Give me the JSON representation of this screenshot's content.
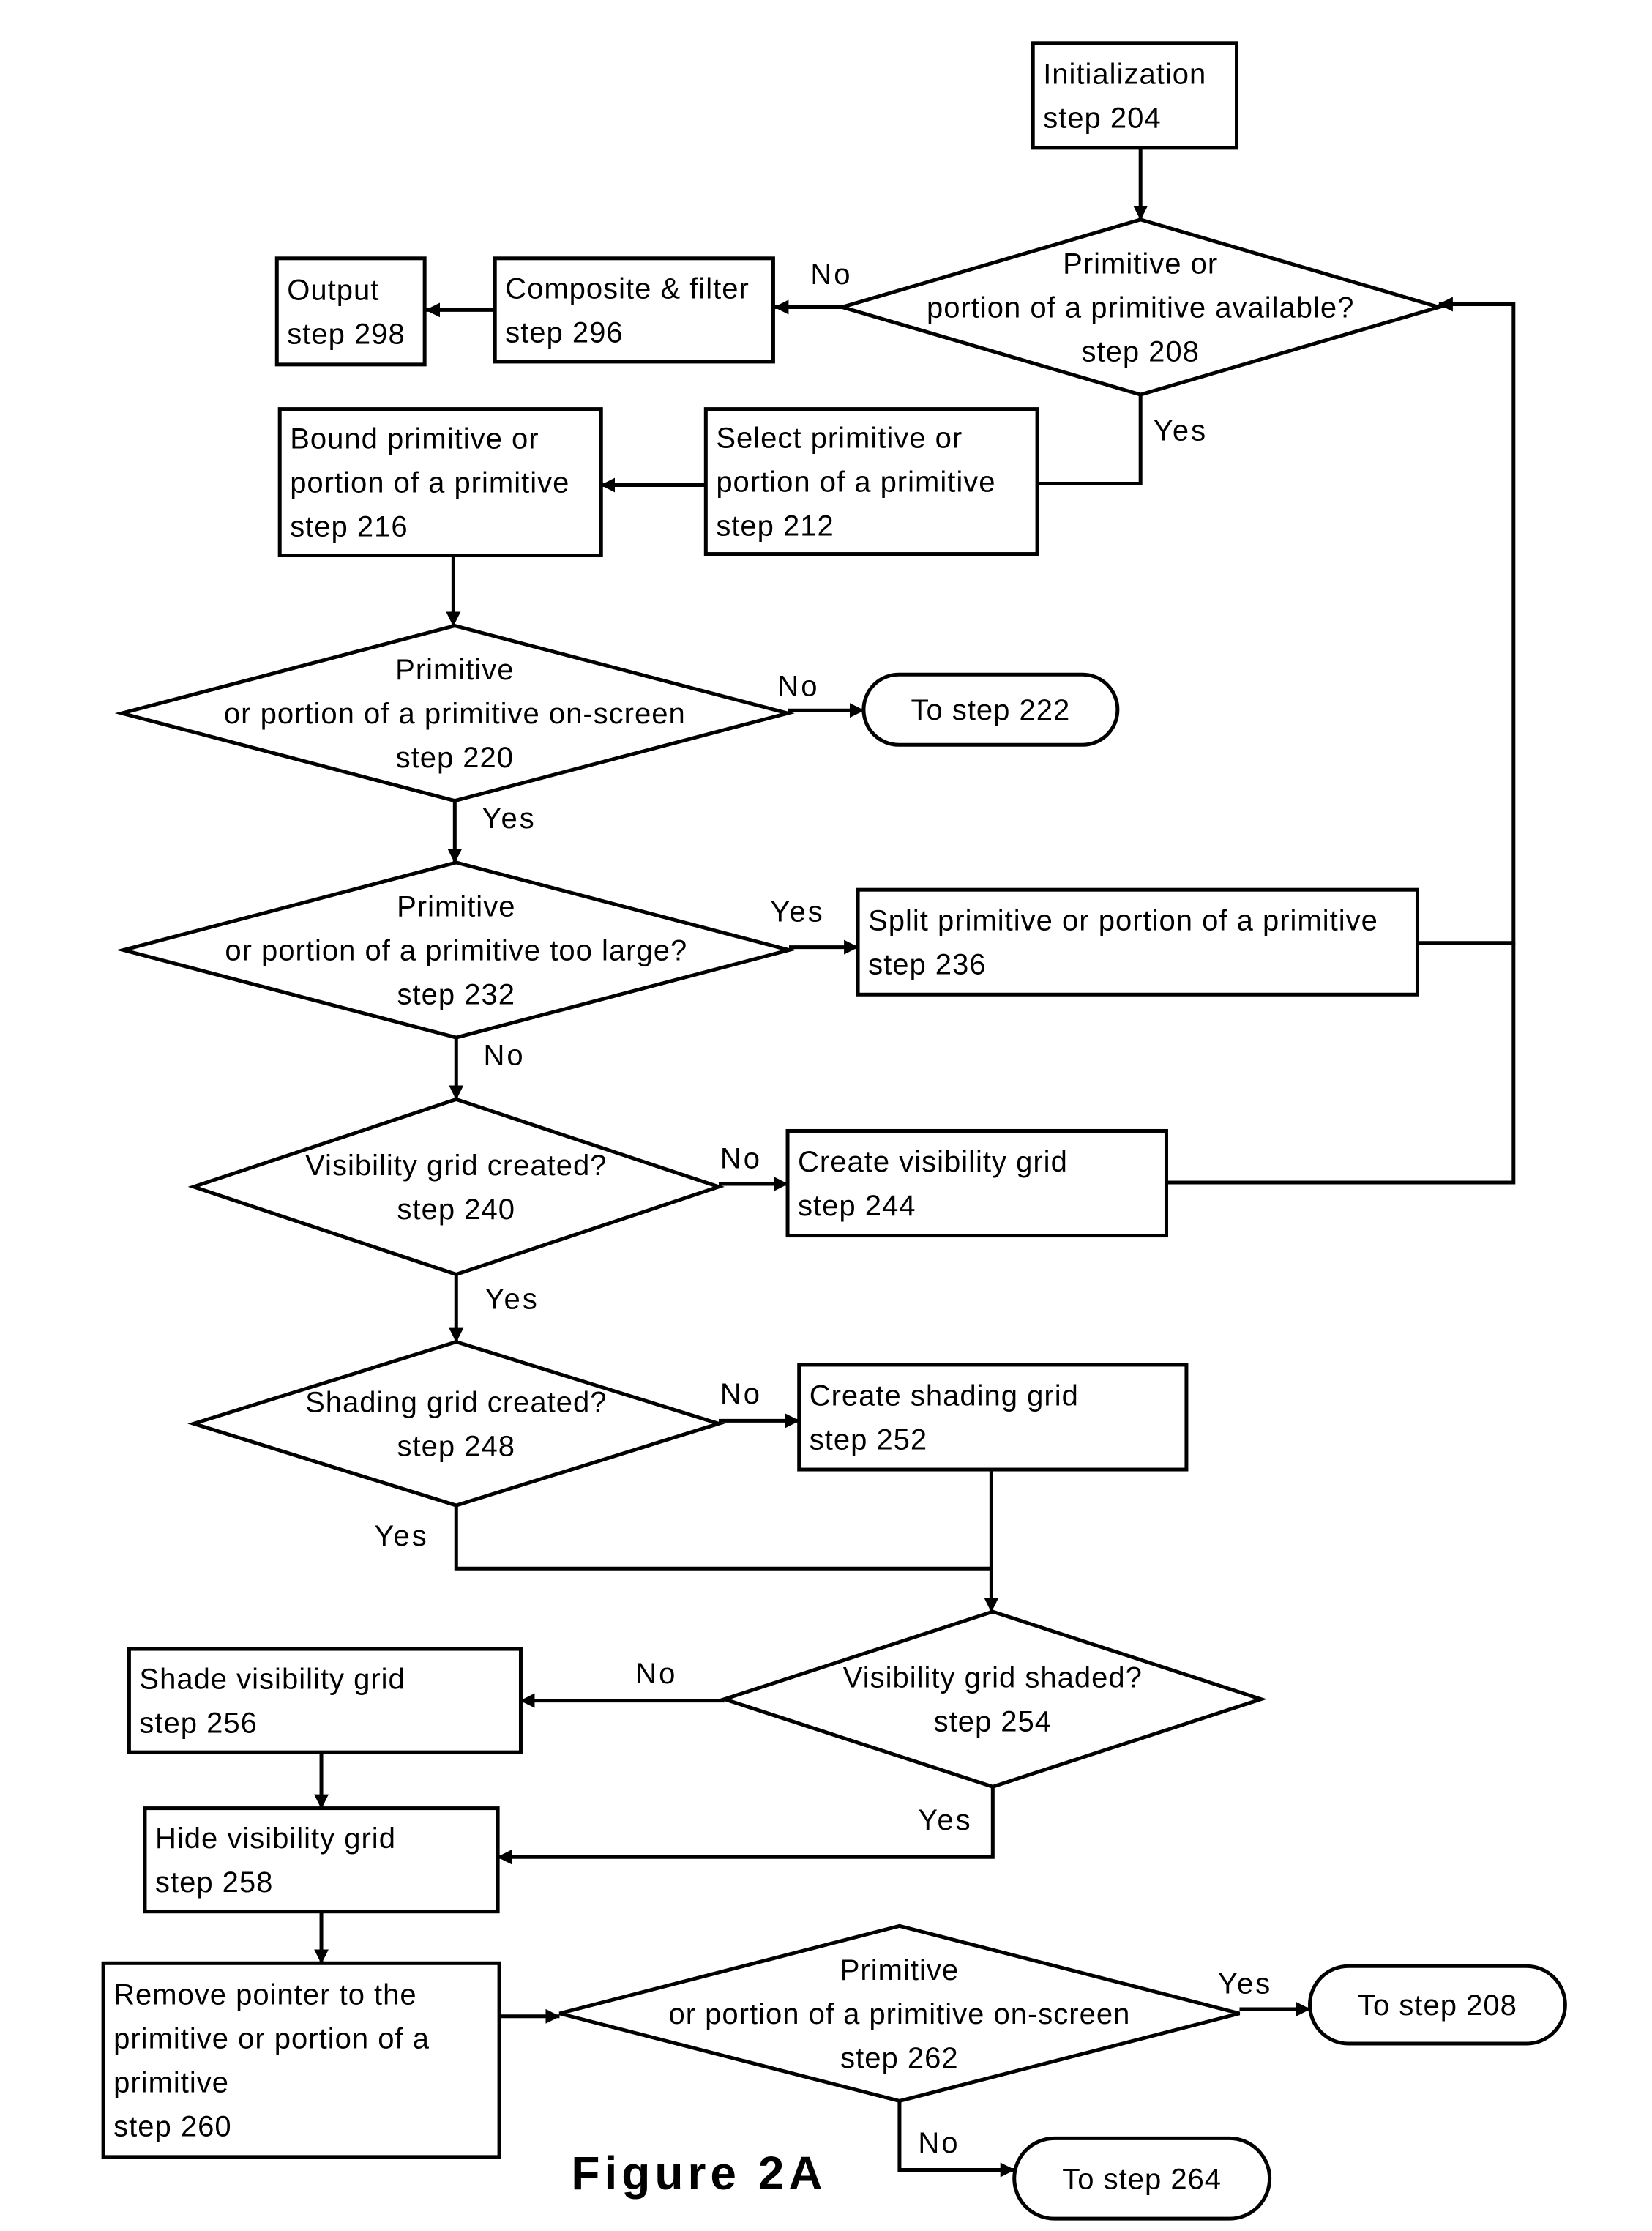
{
  "figure": {
    "caption": "Figure 2A",
    "colors": {
      "stroke": "#000000",
      "background": "#ffffff"
    }
  },
  "nodes": {
    "n204": {
      "type": "process",
      "lines": [
        "Initialization",
        "step 204"
      ]
    },
    "n208": {
      "type": "decision",
      "lines": [
        "Primitive or",
        "portion of a primitive available?",
        "step 208"
      ]
    },
    "n296": {
      "type": "process",
      "lines": [
        "Composite & filter",
        "step 296"
      ]
    },
    "n298": {
      "type": "process",
      "lines": [
        "Output",
        "step 298"
      ]
    },
    "n212": {
      "type": "process",
      "lines": [
        "Select primitive or",
        "portion of a primitive",
        "step 212"
      ]
    },
    "n216": {
      "type": "process",
      "lines": [
        "Bound primitive or",
        "portion of a primitive",
        "step 216"
      ]
    },
    "n220": {
      "type": "decision",
      "lines": [
        "Primitive",
        "or portion of a primitive on-screen",
        "step 220"
      ]
    },
    "t222": {
      "type": "terminal",
      "lines": [
        "To step 222"
      ]
    },
    "n232": {
      "type": "decision",
      "lines": [
        "Primitive",
        "or portion of a primitive too large?",
        "step 232"
      ]
    },
    "n236": {
      "type": "process",
      "lines": [
        "Split primitive or portion of a primitive",
        "step 236"
      ]
    },
    "n240": {
      "type": "decision",
      "lines": [
        "Visibility grid created?",
        "step 240"
      ]
    },
    "n244": {
      "type": "process",
      "lines": [
        "Create visibility grid",
        "step 244"
      ]
    },
    "n248": {
      "type": "decision",
      "lines": [
        "Shading grid created?",
        "step 248"
      ]
    },
    "n252": {
      "type": "process",
      "lines": [
        "Create shading grid",
        "step 252"
      ]
    },
    "n254": {
      "type": "decision",
      "lines": [
        "Visibility grid shaded?",
        "step 254"
      ]
    },
    "n256": {
      "type": "process",
      "lines": [
        "Shade visibility grid",
        "step 256"
      ]
    },
    "n258": {
      "type": "process",
      "lines": [
        "Hide visibility grid",
        "step 258"
      ]
    },
    "n260": {
      "type": "process",
      "lines": [
        "Remove pointer to the",
        "primitive or portion of a",
        "primitive",
        "step 260"
      ]
    },
    "n262": {
      "type": "decision",
      "lines": [
        "Primitive",
        "or portion of a primitive on-screen",
        "step 262"
      ]
    },
    "t208": {
      "type": "terminal",
      "lines": [
        "To step 208"
      ]
    },
    "t264": {
      "type": "terminal",
      "lines": [
        "To step 264"
      ]
    }
  },
  "edges": [
    {
      "from": "n204",
      "to": "n208",
      "label": ""
    },
    {
      "from": "n208",
      "to": "n296",
      "label": "No"
    },
    {
      "from": "n296",
      "to": "n298",
      "label": ""
    },
    {
      "from": "n208",
      "to": "n212",
      "label": "Yes"
    },
    {
      "from": "n212",
      "to": "n216",
      "label": ""
    },
    {
      "from": "n216",
      "to": "n220",
      "label": ""
    },
    {
      "from": "n220",
      "to": "t222",
      "label": "No"
    },
    {
      "from": "n220",
      "to": "n232",
      "label": "Yes"
    },
    {
      "from": "n232",
      "to": "n236",
      "label": "Yes"
    },
    {
      "from": "n236",
      "to": "n208",
      "label": ""
    },
    {
      "from": "n232",
      "to": "n240",
      "label": "No"
    },
    {
      "from": "n240",
      "to": "n244",
      "label": "No"
    },
    {
      "from": "n244",
      "to": "n208",
      "label": ""
    },
    {
      "from": "n240",
      "to": "n248",
      "label": "Yes"
    },
    {
      "from": "n248",
      "to": "n252",
      "label": "No"
    },
    {
      "from": "n248",
      "to": "n254",
      "label": "Yes"
    },
    {
      "from": "n252",
      "to": "n254",
      "label": ""
    },
    {
      "from": "n254",
      "to": "n256",
      "label": "No"
    },
    {
      "from": "n254",
      "to": "n258",
      "label": "Yes"
    },
    {
      "from": "n256",
      "to": "n258",
      "label": ""
    },
    {
      "from": "n258",
      "to": "n260",
      "label": ""
    },
    {
      "from": "n260",
      "to": "n262",
      "label": ""
    },
    {
      "from": "n262",
      "to": "t208",
      "label": "Yes"
    },
    {
      "from": "n262",
      "to": "t264",
      "label": "No"
    }
  ]
}
